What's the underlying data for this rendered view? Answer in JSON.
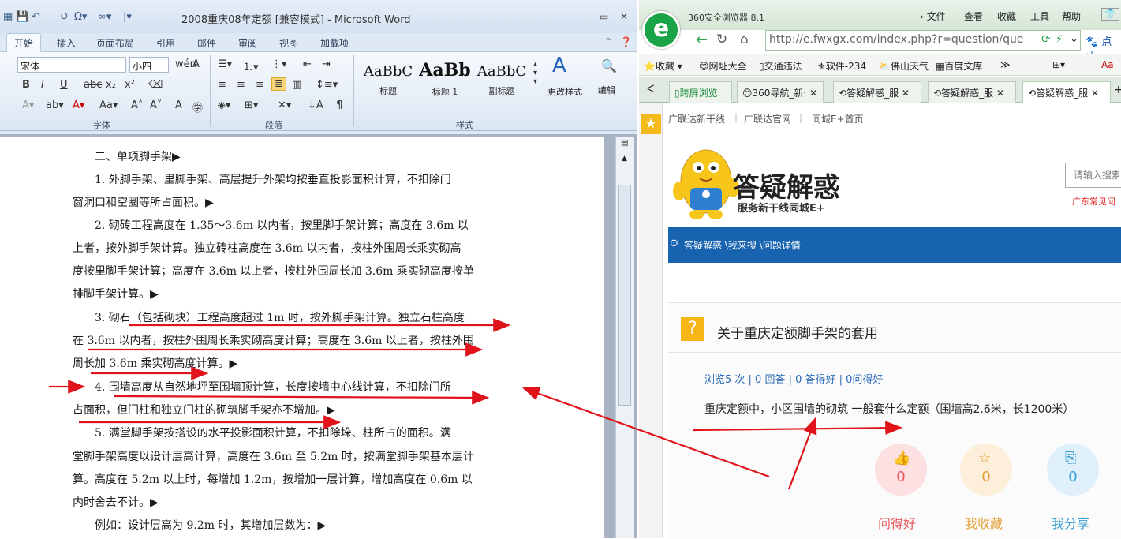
{
  "word": {
    "title": "2008重庆08年定额 [兼容模式] - Microsoft Word",
    "tabs": [
      "开始",
      "插入",
      "页面布局",
      "引用",
      "邮件",
      "审阅",
      "视图",
      "加载项"
    ],
    "font_name": "宋体",
    "font_size": "小四",
    "styles": [
      {
        "preview": "AaBbC",
        "name": "标题"
      },
      {
        "preview": "AaBb",
        "name": "标题 1"
      },
      {
        "preview": "AaBbC",
        "name": "副标题"
      }
    ],
    "change_styles": "更改样式",
    "edit": "编辑",
    "group_font": "字体",
    "group_para": "段落",
    "group_styles": "样式",
    "doc_lines": [
      "　　二、单项脚手架▶",
      "　　1. 外脚手架、里脚手架、高层提升外架均按垂直投影面积计算，不扣除门",
      "窗洞口和空圈等所占面积。▶",
      "　　2. 砌砖工程高度在 1.35～3.6m 以内者，按里脚手架计算；高度在 3.6m 以",
      "上者，按外脚手架计算。独立砖柱高度在 3.6m 以内者，按柱外围周长乘实砌高",
      "度按里脚手架计算；高度在 3.6m 以上者，按柱外围周长加 3.6m 乘实砌高度按单",
      "排脚手架计算。▶",
      "　　3. 砌石（包括砌块）工程高度超过 1m 时，按外脚手架计算。独立石柱高度",
      "在 3.6m 以内者，按柱外围周长乘实砌高度计算；高度在 3.6m 以上者，按柱外围",
      "周长加 3.6m 乘实砌高度计算。▶",
      "　　4. 围墙高度从自然地坪至围墙顶计算，长度按墙中心线计算，不扣除门所",
      "占面积，但门柱和独立门柱的砌筑脚手架亦不增加。▶",
      "　　5. 满堂脚手架按搭设的水平投影面积计算，不扣除垛、柱所占的面积。满",
      "堂脚手架高度以设计层高计算，高度在 3.6m 至 5.2m 时，按满堂脚手架基本层计",
      "算。高度在 5.2m 以上时，每增加 1.2m，按增加一层计算，增加高度在 0.6m 以",
      "内时舍去不计。▶",
      "　　例如：设计层高为 9.2m 时，其增加层数为：▶"
    ]
  },
  "browser": {
    "title": "360安全浏览器 8.1",
    "menu": [
      "文件",
      "查看",
      "收藏",
      "工具",
      "帮助"
    ],
    "url": "http://e.fwxgx.com/index.php?r=question/que",
    "favs": [
      "收藏",
      "网址大全",
      "交通违法",
      "软件-234",
      "佛山天气",
      "百度文库"
    ],
    "tabs": [
      "跨屏浏览",
      "360导航_新·",
      "答疑解惑_服",
      "答疑解惑_服",
      "答疑解惑_服"
    ],
    "top_links": [
      "广联达新干线",
      "广联达官网",
      "同城E+首页"
    ],
    "site_title": "答疑解惑",
    "site_sub": "服务新干线同城E+",
    "search_placeholder": "请输入搜索",
    "hot_text": "广东常见问",
    "breadcrumb": "答疑解惑 \\我来搜 \\问题详情",
    "question_title": "关于重庆定额脚手架的套用",
    "stats": "浏览5 次 | 0 回答 | 0 答得好 | 0问得好",
    "question_body": "重庆定额中，小区围墙的砌筑 一般套什么定额（围墙高2.6米，长1200米）",
    "actions": [
      {
        "label": "问得好",
        "count": "0",
        "color": "#e8575c",
        "bg": "#fde0e1"
      },
      {
        "label": "我收藏",
        "count": "0",
        "color": "#e3a13a",
        "bg": "#fdefd9"
      },
      {
        "label": "我分享",
        "count": "0",
        "color": "#3a9fd6",
        "bg": "#dff0fa"
      }
    ]
  },
  "annotation_color": "#e0121a"
}
